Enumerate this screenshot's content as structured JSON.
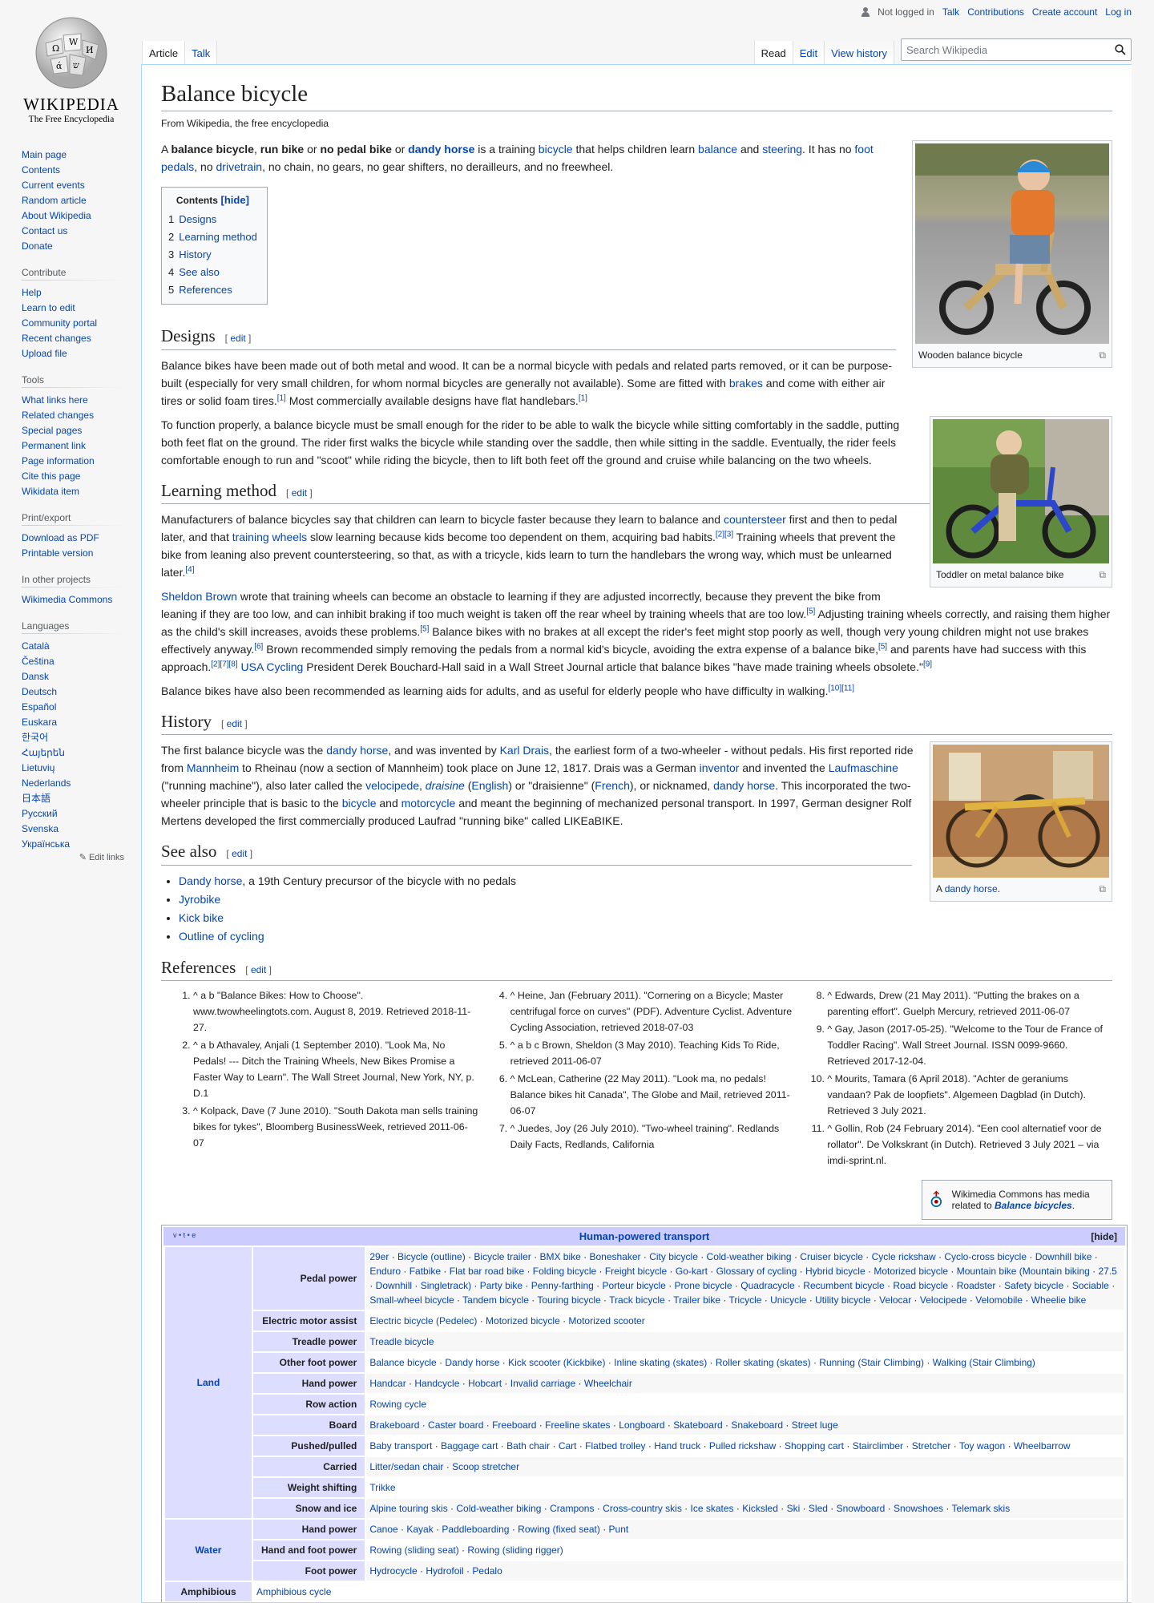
{
  "personal": {
    "not_logged_in": "Not logged in",
    "talk": "Talk",
    "contributions": "Contributions",
    "create_account": "Create account",
    "log_in": "Log in"
  },
  "logo": {
    "wordmark": "WIKIPEDIA",
    "tagline": "The Free Encyclopedia"
  },
  "sidebar": {
    "nav": [
      "Main page",
      "Contents",
      "Current events",
      "Random article",
      "About Wikipedia",
      "Contact us",
      "Donate"
    ],
    "contribute_title": "Contribute",
    "contribute": [
      "Help",
      "Learn to edit",
      "Community portal",
      "Recent changes",
      "Upload file"
    ],
    "tools_title": "Tools",
    "tools": [
      "What links here",
      "Related changes",
      "Special pages",
      "Permanent link",
      "Page information",
      "Cite this page",
      "Wikidata item"
    ],
    "print_title": "Print/export",
    "print": [
      "Download as PDF",
      "Printable version"
    ],
    "other_title": "In other projects",
    "other": [
      "Wikimedia Commons"
    ],
    "languages_title": "Languages",
    "languages": [
      "Català",
      "Čeština",
      "Dansk",
      "Deutsch",
      "Español",
      "Euskara",
      "한국어",
      "Հայերեն",
      "Lietuvių",
      "Nederlands",
      "日本語",
      "Русский",
      "Svenska",
      "Українська"
    ],
    "edit_links": "Edit links"
  },
  "tabs": {
    "article": "Article",
    "talk": "Talk",
    "read": "Read",
    "edit": "Edit",
    "history": "View history",
    "search_placeholder": "Search Wikipedia"
  },
  "article": {
    "title": "Balance bicycle",
    "subtitle": "From Wikipedia, the free encyclopedia",
    "intro": {
      "a": "A ",
      "b1": "balance bicycle",
      ",": ", ",
      "b2": "run bike",
      "or": " or ",
      "b3": "no pedal bike",
      "or2": " or ",
      "l1": "dandy horse",
      "t1": " is a training ",
      "l2": "bicycle",
      "t2": " that helps children learn ",
      "l3": "balance",
      "t3": " and ",
      "l4": "steering",
      "t4": ". It has no ",
      "l5": "foot pedals",
      "t5": ", no ",
      "l6": "drivetrain",
      "t6": ", no chain, no gears, no gear shifters, no derailleurs, and no freewheel."
    },
    "toc": {
      "title": "Contents",
      "hide": "[hide]",
      "items": [
        {
          "n": "1",
          "t": "Designs"
        },
        {
          "n": "2",
          "t": "Learning method"
        },
        {
          "n": "3",
          "t": "History"
        },
        {
          "n": "4",
          "t": "See also"
        },
        {
          "n": "5",
          "t": "References"
        }
      ]
    },
    "edit": "edit",
    "h_designs": "Designs",
    "designs_p1a": "Balance bikes have been made out of both metal and wood. It can be a normal bicycle with pedals and related parts removed, or it can be purpose-built (especially for very small children, for whom normal bicycles are generally not available). Some are fitted with ",
    "designs_p1_l": "brakes",
    "designs_p1b": " and come with either air tires or solid foam tires.",
    "designs_p1c": " Most commercially available designs have flat handlebars.",
    "designs_p2": "To function properly, a balance bicycle must be small enough for the rider to be able to walk the bicycle while sitting comfortably in the saddle, putting both feet flat on the ground. The rider first walks the bicycle while standing over the saddle, then while sitting in the saddle. Eventually, the rider feels comfortable enough to run and \"scoot\" while riding the bicycle, then to lift both feet off the ground and cruise while balancing on the two wheels.",
    "h_learning": "Learning method",
    "lm_p1a": "Manufacturers of balance bicycles say that children can learn to bicycle faster because they learn to balance and ",
    "lm_p1_l1": "countersteer",
    "lm_p1b": " first and then to pedal later, and that ",
    "lm_p1_l2": "training wheels",
    "lm_p1c": " slow learning because kids become too dependent on them, acquiring bad habits.",
    "lm_p1d": " Training wheels that prevent the bike from leaning also prevent countersteering, so that, as with a tricycle, kids learn to turn the handlebars the wrong way, which must be unlearned later.",
    "lm_p2_l1": "Sheldon Brown",
    "lm_p2a": " wrote that training wheels can become an obstacle to learning if they are adjusted incorrectly, because they prevent the bike from leaning if they are too low, and can inhibit braking if too much weight is taken off the rear wheel by training wheels that are too low.",
    "lm_p2b": " Adjusting training wheels correctly, and raising them higher as the child's skill increases, avoids these problems.",
    "lm_p2c": " Balance bikes with no brakes at all except the rider's feet might stop poorly as well, though very young children might not use brakes effectively anyway.",
    "lm_p2d": " Brown recommended simply removing the pedals from a normal kid's bicycle, avoiding the extra expense of a balance bike,",
    "lm_p2e": " and parents have had success with this approach.",
    "lm_p2_l2": "USA Cycling",
    "lm_p2f": " President Derek Bouchard-Hall said in a Wall Street Journal article that balance bikes \"have made training wheels obsolete.\"",
    "lm_p3": "Balance bikes have also been recommended as learning aids for adults, and as useful for elderly people who have difficulty in walking.",
    "h_history": "History",
    "hist": {
      "a": "The first balance bicycle was the ",
      "l1": "dandy horse",
      "b": ", and was invented by ",
      "l2": "Karl Drais",
      "c": ", the earliest form of a two-wheeler - without pedals. His first reported ride from ",
      "l3": "Mannheim",
      "d": " to Rheinau (now a section of Mannheim) took place on June 12, 1817. Drais was a German ",
      "l4": "inventor",
      "e": " and invented the ",
      "l5": "Laufmaschine",
      "f": " (\"running machine\"), also later called the ",
      "l6": "velocipede",
      "g": ", ",
      "l7": "draisine",
      "h": " (",
      "l8": "English",
      "i": ") or \"draisienne\" (",
      "l9": "French",
      "j": "), or nicknamed, ",
      "l10": "dandy horse",
      "k": ". This incorporated the two-wheeler principle that is basic to the ",
      "l11": "bicycle",
      "m": " and ",
      "l12": "motorcycle",
      "n": " and meant the beginning of mechanized personal transport. In 1997, German designer Rolf Mertens developed the first commercially produced Laufrad \"running bike\" called LIKEaBIKE."
    },
    "h_seealso": "See also",
    "seealso": [
      {
        "l": "Dandy horse",
        "t": ", a 19th Century precursor of the bicycle with no pedals"
      },
      {
        "l": "Jyrobike",
        "t": ""
      },
      {
        "l": "Kick bike",
        "t": ""
      },
      {
        "l": "Outline of cycling",
        "t": ""
      }
    ],
    "h_refs": "References",
    "refs_col1": [
      "^ a b \"Balance Bikes: How to Choose\". www.twowheelingtots.com. August 8, 2019. Retrieved 2018-11-27.",
      "^ a b Athavaley, Anjali (1 September 2010). \"Look Ma, No Pedals! --- Ditch the Training Wheels, New Bikes Promise a Faster Way to Learn\". The Wall Street Journal, New York, NY, p. D.1",
      "^ Kolpack, Dave (7 June 2010). \"South Dakota man sells training bikes for tykes\", Bloomberg BusinessWeek, retrieved 2011-06-07"
    ],
    "refs_col2": [
      "^ Heine, Jan (February 2011). \"Cornering on a Bicycle; Master centrifugal force on curves\" (PDF). Adventure Cyclist. Adventure Cycling Association, retrieved 2018-07-03",
      "^ a b c Brown, Sheldon (3 May 2010). Teaching Kids To Ride, retrieved 2011-06-07",
      "^ McLean, Catherine (22 May 2011). \"Look ma, no pedals! Balance bikes hit Canada\", The Globe and Mail, retrieved 2011-06-07",
      "^ Juedes, Joy (26 July 2010). \"Two-wheel training\". Redlands Daily Facts, Redlands, California"
    ],
    "refs_col3": [
      "^ Edwards, Drew (21 May 2011). \"Putting the brakes on a parenting effort\". Guelph Mercury, retrieved 2011-06-07",
      "^ Gay, Jason (2017-05-25). \"Welcome to the Tour de France of Toddler Racing\". Wall Street Journal. ISSN 0099-9660. Retrieved 2017-12-04.",
      "^ Mourits, Tamara (6 April 2018). \"Achter de geraniums vandaan? Pak de loopfiets\". Algemeen Dagblad (in Dutch). Retrieved 3 July 2021.",
      "^ Gollin, Rob (24 February 2014). \"Een cool alternatief voor de rollator\". De Volkskrant (in Dutch). Retrieved 3 July 2021 – via imdi-sprint.nl."
    ],
    "commons": {
      "a": "Wikimedia Commons has media related to ",
      "l": "Balance bicycles",
      "b": "."
    }
  },
  "images": [
    {
      "caption": "Wooden balance bicycle"
    },
    {
      "caption": "Toddler on metal balance bike"
    },
    {
      "caption_a": "A ",
      "caption_l": "dandy horse",
      "caption_b": "."
    }
  ],
  "navbox": {
    "vte": "v • t • e",
    "title": "Human-powered transport",
    "hide": "[hide]",
    "land": "Land",
    "water": "Water",
    "rows": [
      {
        "h": "Pedal power",
        "v": "29er · Bicycle (outline) · Bicycle trailer · BMX bike · Boneshaker · City bicycle · Cold-weather biking · Cruiser bicycle · Cycle rickshaw · Cyclo-cross bicycle · Downhill bike · Enduro · Fatbike · Flat bar road bike · Folding bicycle · Freight bicycle · Go-kart · Glossary of cycling · Hybrid bicycle · Motorized bicycle · Mountain bike (Mountain biking · 27.5 · Downhill · Singletrack) · Party bike · Penny-farthing · Porteur bicycle · Prone bicycle · Quadracycle · Recumbent bicycle · Road bicycle · Roadster · Safety bicycle · Sociable · Small-wheel bicycle · Tandem bicycle · Touring bicycle · Track bicycle · Trailer bike · Tricycle · Unicycle · Utility bicycle · Velocar · Velocipede · Velomobile · Wheelie bike"
      },
      {
        "h": "Electric motor assist",
        "v": "Electric bicycle (Pedelec) · Motorized bicycle · Motorized scooter"
      },
      {
        "h": "Treadle power",
        "v": "Treadle bicycle"
      },
      {
        "h": "Other foot power",
        "v": "Balance bicycle · Dandy horse · Kick scooter (Kickbike) · Inline skating (skates) · Roller skating (skates) · Running (Stair Climbing) · Walking (Stair Climbing)"
      },
      {
        "h": "Hand power",
        "v": "Handcar · Handcycle · Hobcart · Invalid carriage · Wheelchair"
      },
      {
        "h": "Row action",
        "v": "Rowing cycle"
      },
      {
        "h": "Board",
        "v": "Brakeboard · Caster board · Freeboard · Freeline skates · Longboard · Skateboard · Snakeboard · Street luge"
      },
      {
        "h": "Pushed/pulled",
        "v": "Baby transport · Baggage cart · Bath chair · Cart · Flatbed trolley · Hand truck · Pulled rickshaw · Shopping cart · Stairclimber · Stretcher · Toy wagon · Wheelbarrow"
      },
      {
        "h": "Carried",
        "v": "Litter/sedan chair · Scoop stretcher"
      },
      {
        "h": "Weight shifting",
        "v": "Trikke"
      },
      {
        "h": "Snow and ice",
        "v": "Alpine touring skis · Cold-weather biking · Crampons · Cross-country skis · Ice skates · Kicksled · Ski · Sled · Snowboard · Snowshoes · Telemark skis"
      }
    ],
    "water_rows": [
      {
        "h": "Hand power",
        "v": "Canoe · Kayak · Paddleboarding · Rowing (fixed seat) · Punt"
      },
      {
        "h": "Hand and foot power",
        "v": "Rowing (sliding seat) · Rowing (sliding rigger)"
      },
      {
        "h": "Foot power",
        "v": "Hydrocycle · Hydrofoil · Pedalo"
      }
    ],
    "amphibious": "Amphibious",
    "amphibious_v": "Amphibious cycle"
  }
}
